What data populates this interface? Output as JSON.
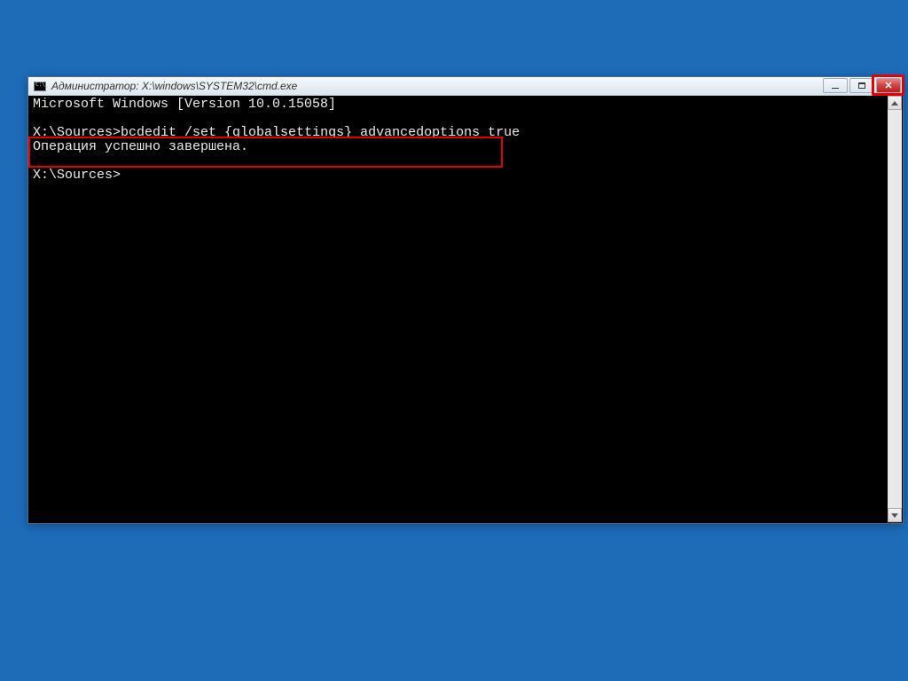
{
  "titlebar": {
    "title": "Администратор: X:\\windows\\SYSTEM32\\cmd.exe"
  },
  "console": {
    "line1": "Microsoft Windows [Version 10.0.15058]",
    "blank1": "",
    "line2_prompt": "X:\\Sources>",
    "line2_cmd": "bcdedit /set {globalsettings} advancedoptions true",
    "line3": "Операция успешно завершена.",
    "blank2": "",
    "line4_prompt": "X:\\Sources>"
  }
}
